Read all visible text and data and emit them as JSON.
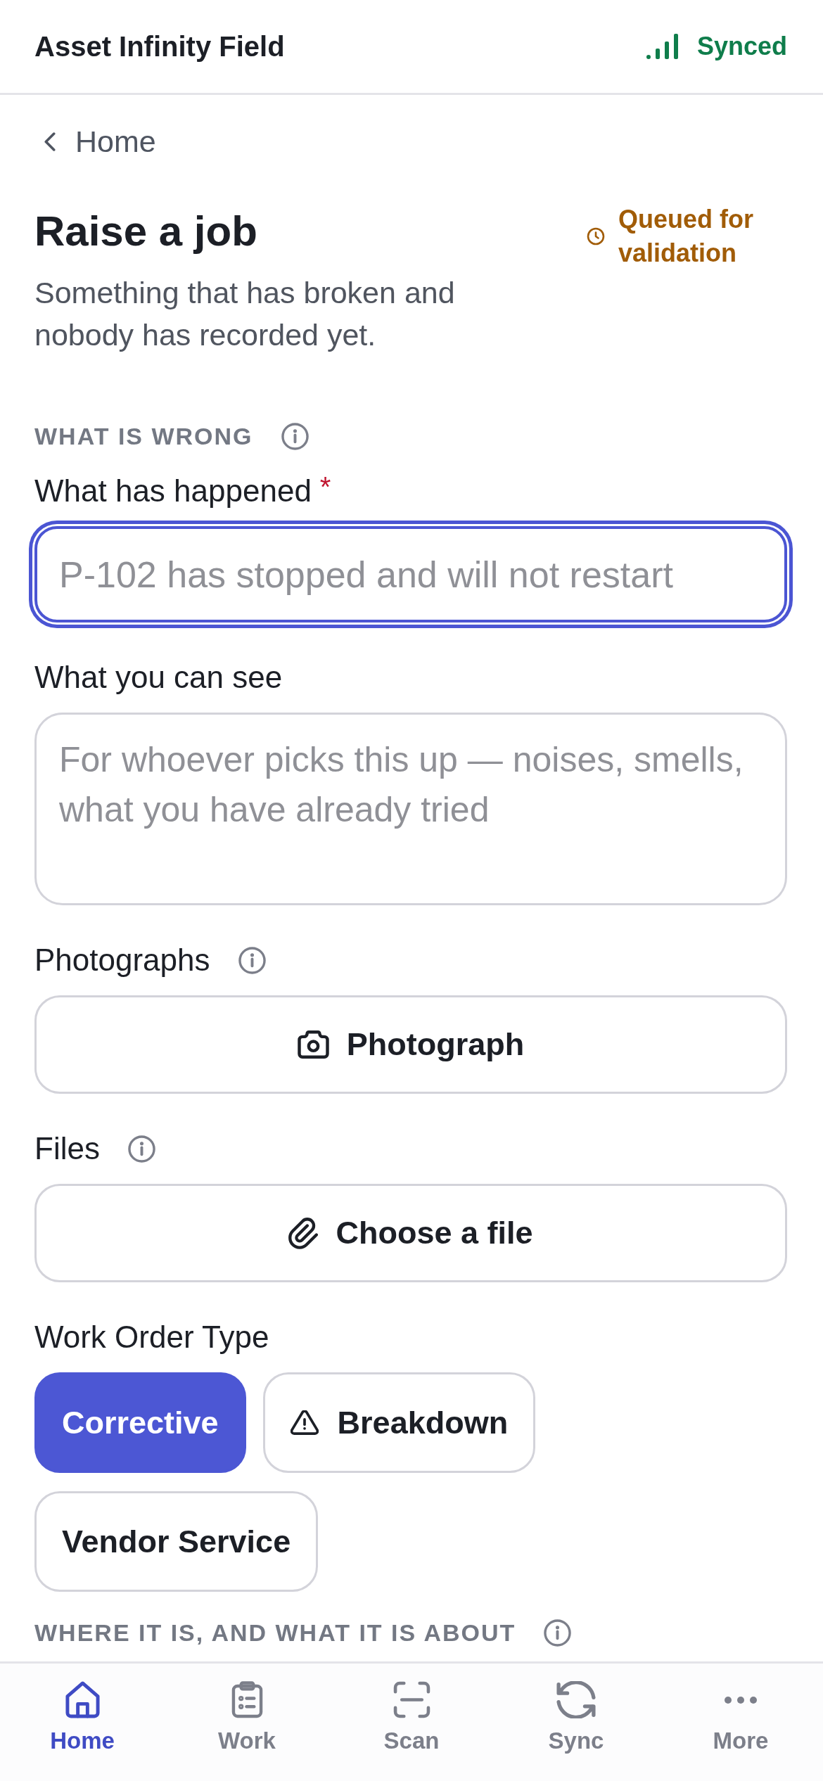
{
  "app_bar": {
    "title": "Asset Infinity Field",
    "sync_status": "Synced"
  },
  "breadcrumb": {
    "label": "Home"
  },
  "page_header": {
    "title": "Raise a job",
    "subtitle": "Something that has broken and nobody has recorded yet.",
    "status": "Queued for validation"
  },
  "sections": [
    {
      "heading": "WHAT IS WRONG",
      "info": true,
      "fields": [
        {
          "kind": "text",
          "label": "What has happened",
          "required_mark": "*",
          "info": false,
          "focused": true,
          "placeholder": "P-102 has stopped and will not restart"
        },
        {
          "kind": "textarea",
          "label": "What you can see",
          "info": false,
          "focused": false,
          "placeholder": "For whoever picks this up — noises, smells, what you have already tried"
        },
        {
          "kind": "photo",
          "label": "Photographs",
          "info": true,
          "button": "Photograph"
        },
        {
          "kind": "file",
          "label": "Files",
          "info": true,
          "button": "Choose a file"
        },
        {
          "kind": "choice",
          "label": "Work Order Type",
          "info": false,
          "options": [
            {
              "label": "Corrective",
              "kind": "plain",
              "selected": true
            },
            {
              "label": "Breakdown",
              "kind": "alert",
              "selected": false
            },
            {
              "label": "Vendor Service",
              "kind": "plain",
              "selected": false
            }
          ]
        }
      ]
    },
    {
      "heading": "WHERE IT IS, AND WHAT IT IS ABOUT",
      "info": true
    }
  ],
  "nav": [
    {
      "label": "Home",
      "selected": true
    },
    {
      "label": "Work",
      "selected": false
    },
    {
      "label": "Scan",
      "selected": false
    },
    {
      "label": "Sync",
      "selected": false
    },
    {
      "label": "More",
      "selected": false
    }
  ]
}
